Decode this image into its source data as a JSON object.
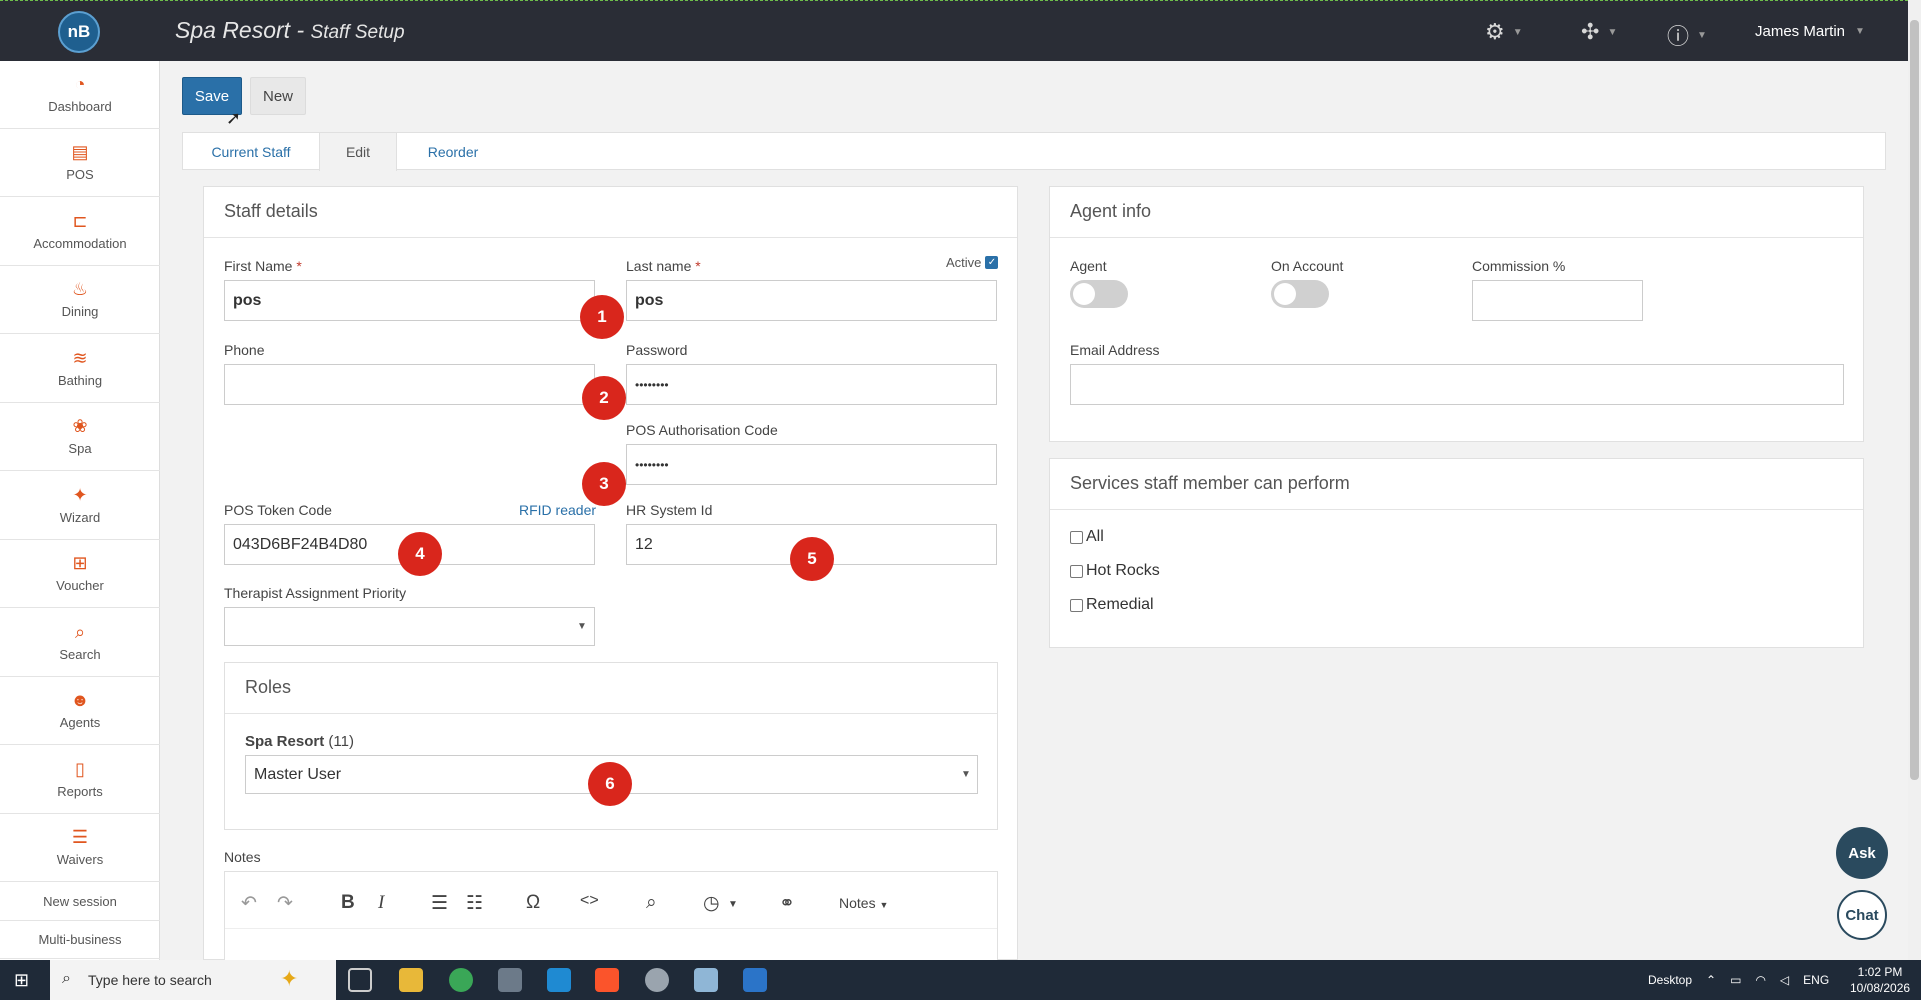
{
  "header": {
    "app_name": "Spa Resort",
    "separator": " - ",
    "page_name": "Staff Setup",
    "logo_text": "nB",
    "user_name": "James Martin",
    "icons": [
      "settings-gear-icon",
      "integrations-icon",
      "help-icon"
    ]
  },
  "sidebar": {
    "items": [
      {
        "label": "Dashboard",
        "icon": "dashboard-icon"
      },
      {
        "label": "POS",
        "icon": "pos-register-icon"
      },
      {
        "label": "Accommodation",
        "icon": "bed-icon"
      },
      {
        "label": "Dining",
        "icon": "dining-icon"
      },
      {
        "label": "Bathing",
        "icon": "waves-icon"
      },
      {
        "label": "Spa",
        "icon": "lotus-icon"
      },
      {
        "label": "Wizard",
        "icon": "magic-wand-icon"
      },
      {
        "label": "Voucher",
        "icon": "gift-icon"
      },
      {
        "label": "Search",
        "icon": "search-icon"
      },
      {
        "label": "Agents",
        "icon": "users-icon"
      },
      {
        "label": "Reports",
        "icon": "report-icon"
      },
      {
        "label": "Waivers",
        "icon": "checklist-icon"
      }
    ],
    "links": [
      "New session",
      "Multi-business"
    ]
  },
  "toolbar": {
    "save_label": "Save",
    "new_label": "New"
  },
  "tabs": [
    {
      "label": "Current Staff",
      "active": false
    },
    {
      "label": "Edit",
      "active": true
    },
    {
      "label": "Reorder",
      "active": false
    }
  ],
  "staff_details": {
    "title": "Staff details",
    "active_label": "Active",
    "active_checked": true,
    "first_name_label": "First Name",
    "first_name_value": "pos",
    "last_name_label": "Last name",
    "last_name_value": "pos",
    "required_mark": "*",
    "phone_label": "Phone",
    "phone_value": "",
    "password_label": "Password",
    "password_value": "••••••••",
    "pos_auth_label": "POS Authorisation Code",
    "pos_auth_value": "••••••••",
    "pos_token_label": "POS Token Code",
    "pos_token_value": "043D6BF24B4D80",
    "rfid_link": "RFID reader",
    "hr_label": "HR System Id",
    "hr_value": "12",
    "therapist_label": "Therapist Assignment Priority",
    "therapist_value": ""
  },
  "roles": {
    "title": "Roles",
    "business_name": "Spa Resort",
    "business_count": "(11)",
    "selected_role": "Master User"
  },
  "notes": {
    "label": "Notes",
    "toolbar_dropdown": "Notes"
  },
  "annotations": [
    "1",
    "2",
    "3",
    "4",
    "5",
    "6"
  ],
  "agent_info": {
    "title": "Agent info",
    "agent_label": "Agent",
    "agent_on": false,
    "on_account_label": "On Account",
    "on_account_on": false,
    "commission_label": "Commission %",
    "commission_value": "",
    "email_label": "Email Address",
    "email_value": ""
  },
  "services": {
    "title": "Services staff member can perform",
    "options": [
      {
        "label": "All",
        "checked": false
      },
      {
        "label": "Hot Rocks",
        "checked": false
      },
      {
        "label": "Remedial",
        "checked": false
      }
    ]
  },
  "floating": {
    "ask_label": "Ask",
    "chat_label": "Chat"
  },
  "taskbar": {
    "search_placeholder": "Type here to search",
    "desktop_label": "Desktop",
    "language": "ENG",
    "time": "1:02 PM",
    "date": "10/08/2026"
  },
  "colors": {
    "brand_blue": "#2a70a8",
    "topbar": "#2a2d36",
    "sidebar_icon": "#e0561f",
    "badge_red": "#d9261c"
  }
}
